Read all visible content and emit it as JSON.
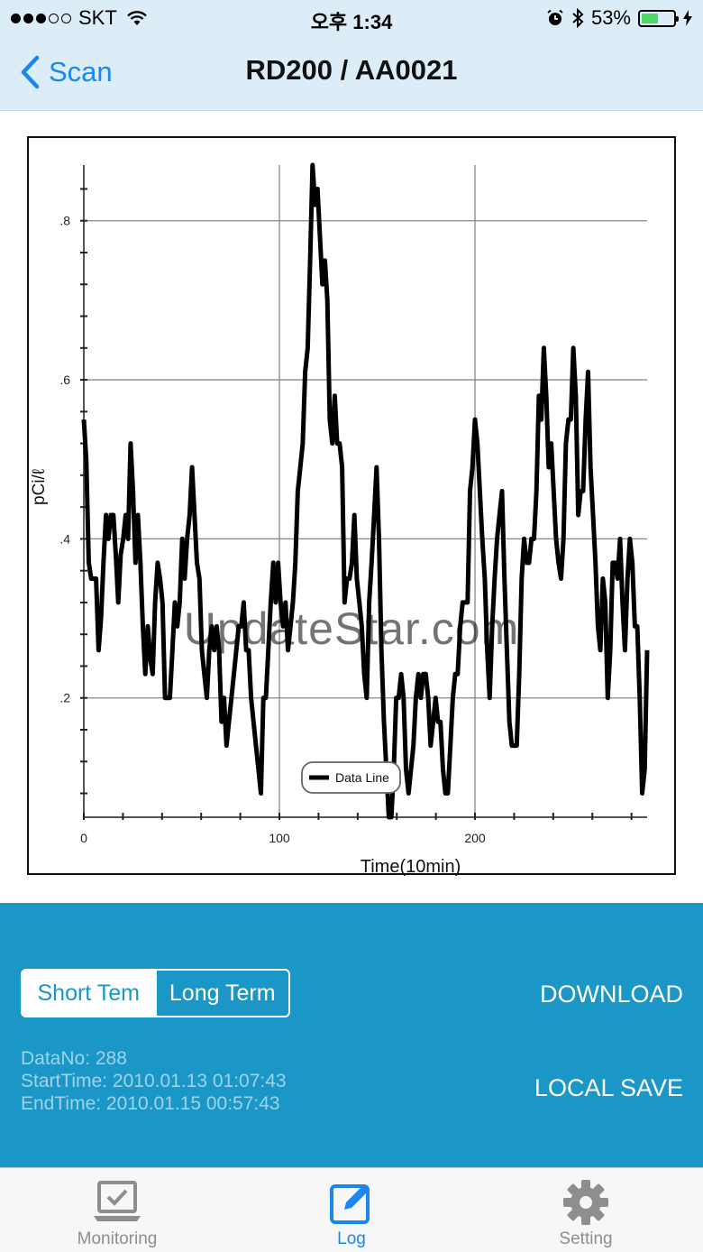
{
  "status": {
    "carrier": "SKT",
    "time": "오후 1:34",
    "battery": "53%",
    "battery_level": 0.53
  },
  "nav": {
    "back_label": "Scan",
    "title": "RD200 / AA0021"
  },
  "chart_data": {
    "type": "line",
    "xlabel": "Time(10min)",
    "ylabel": "pCi/ℓ",
    "xlim": [
      0,
      288
    ],
    "ylim": [
      0.05,
      0.87
    ],
    "x_ticks": [
      0,
      100,
      200
    ],
    "x_tick_labels": [
      "0",
      "100",
      "200"
    ],
    "y_ticks": [
      0.2,
      0.4,
      0.6,
      0.8
    ],
    "y_tick_labels": [
      ".2",
      ".4",
      ".6",
      ".8"
    ],
    "grid": true,
    "legend": "bottom-center",
    "series": [
      {
        "name": "Data Line",
        "color": "#000000",
        "values": [
          0.55,
          0.5,
          0.37,
          0.35,
          0.35,
          0.35,
          0.26,
          0.3,
          0.37,
          0.43,
          0.4,
          0.43,
          0.43,
          0.38,
          0.32,
          0.38,
          0.4,
          0.43,
          0.4,
          0.52,
          0.46,
          0.37,
          0.43,
          0.37,
          0.29,
          0.23,
          0.29,
          0.25,
          0.23,
          0.32,
          0.37,
          0.35,
          0.32,
          0.2,
          0.2,
          0.2,
          0.26,
          0.32,
          0.29,
          0.32,
          0.4,
          0.35,
          0.4,
          0.43,
          0.49,
          0.43,
          0.37,
          0.35,
          0.26,
          0.23,
          0.2,
          0.26,
          0.29,
          0.26,
          0.29,
          0.26,
          0.17,
          0.2,
          0.14,
          0.17,
          0.2,
          0.23,
          0.26,
          0.29,
          0.29,
          0.32,
          0.26,
          0.26,
          0.2,
          0.17,
          0.14,
          0.11,
          0.08,
          0.2,
          0.2,
          0.26,
          0.32,
          0.37,
          0.32,
          0.37,
          0.32,
          0.29,
          0.32,
          0.26,
          0.29,
          0.32,
          0.37,
          0.46,
          0.49,
          0.52,
          0.61,
          0.64,
          0.75,
          0.87,
          0.82,
          0.84,
          0.78,
          0.72,
          0.75,
          0.7,
          0.55,
          0.52,
          0.58,
          0.52,
          0.52,
          0.49,
          0.32,
          0.35,
          0.35,
          0.37,
          0.43,
          0.35,
          0.32,
          0.29,
          0.23,
          0.2,
          0.32,
          0.37,
          0.43,
          0.49,
          0.4,
          0.26,
          0.17,
          0.11,
          0.05,
          0.05,
          0.11,
          0.2,
          0.2,
          0.23,
          0.2,
          0.11,
          0.08,
          0.11,
          0.14,
          0.2,
          0.23,
          0.2,
          0.23,
          0.23,
          0.2,
          0.14,
          0.17,
          0.2,
          0.17,
          0.17,
          0.11,
          0.08,
          0.08,
          0.14,
          0.2,
          0.23,
          0.23,
          0.29,
          0.32,
          0.32,
          0.32,
          0.46,
          0.49,
          0.55,
          0.52,
          0.46,
          0.4,
          0.35,
          0.26,
          0.2,
          0.29,
          0.35,
          0.4,
          0.43,
          0.46,
          0.35,
          0.26,
          0.17,
          0.14,
          0.14,
          0.14,
          0.23,
          0.35,
          0.4,
          0.37,
          0.37,
          0.4,
          0.4,
          0.46,
          0.58,
          0.55,
          0.64,
          0.58,
          0.49,
          0.52,
          0.46,
          0.4,
          0.37,
          0.35,
          0.4,
          0.52,
          0.55,
          0.55,
          0.64,
          0.58,
          0.43,
          0.46,
          0.46,
          0.55,
          0.61,
          0.49,
          0.43,
          0.37,
          0.29,
          0.26,
          0.35,
          0.32,
          0.2,
          0.26,
          0.37,
          0.37,
          0.35,
          0.4,
          0.32,
          0.26,
          0.35,
          0.4,
          0.37,
          0.29,
          0.29,
          0.2,
          0.08,
          0.11,
          0.26
        ]
      }
    ]
  },
  "watermark": "UpdateStar.com",
  "panel": {
    "segments": [
      {
        "label": "Short Tem",
        "active": true
      },
      {
        "label": "Long Term",
        "active": false
      }
    ],
    "data_no": "DataNo: 288",
    "start_time": "StartTime: 2010.01.13 01:07:43",
    "end_time": "EndTime: 2010.01.15 00:57:43",
    "download_label": "DOWNLOAD",
    "local_save_label": "LOCAL SAVE"
  },
  "tabs": [
    {
      "label": "Monitoring",
      "icon": "monitor-icon",
      "active": false
    },
    {
      "label": "Log",
      "icon": "log-edit-icon",
      "active": true
    },
    {
      "label": "Setting",
      "icon": "gear-icon",
      "active": false
    }
  ],
  "colors": {
    "accent": "#1a86f0",
    "panel": "#1a97c6",
    "nav_bg": "#dcedf8"
  }
}
